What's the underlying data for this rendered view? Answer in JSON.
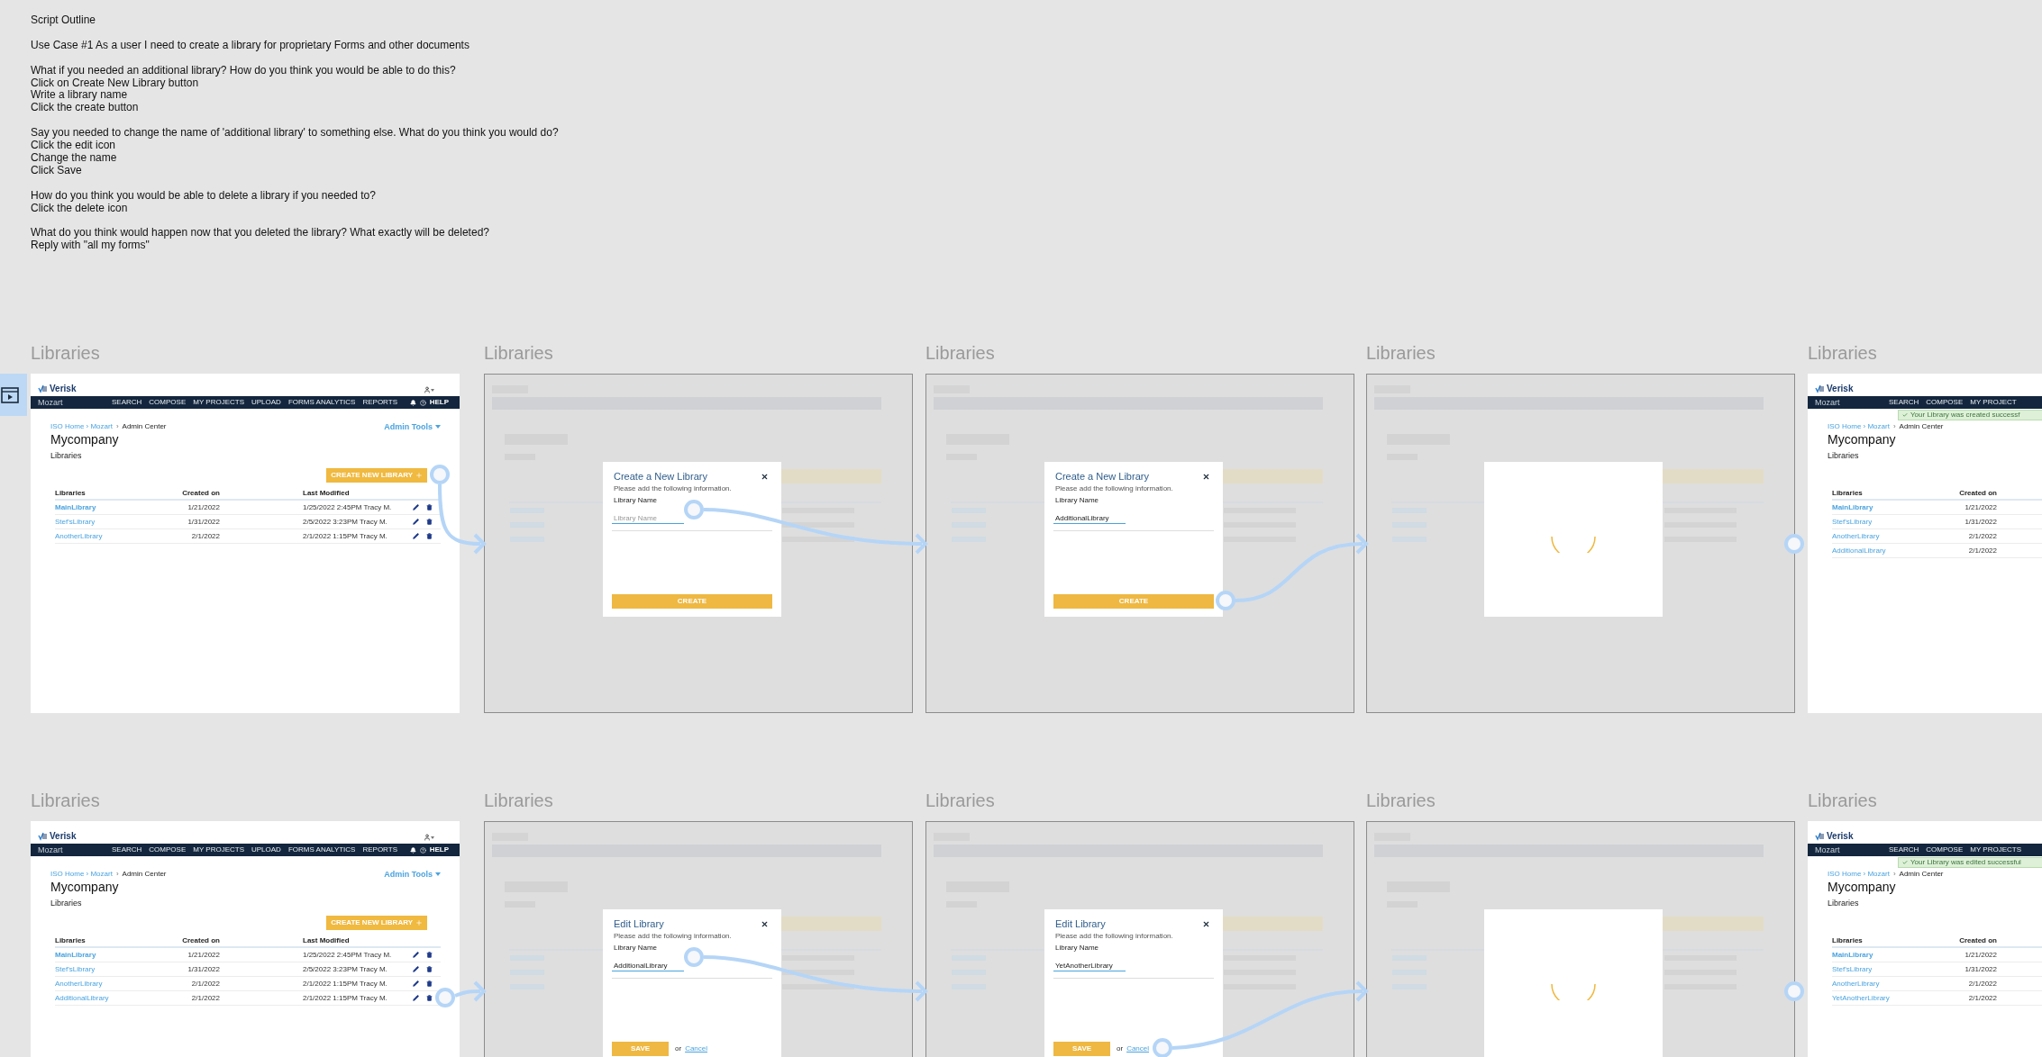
{
  "outline": {
    "title": "Script Outline",
    "paragraphs": [
      [
        "Use Case #1 As a user I need to create a library for proprietary Forms and other documents"
      ],
      [
        "What if you needed an additional library? How do you think you would be able to do this?",
        "Click on Create New Library button",
        "Write a library name",
        "Click the create button"
      ],
      [
        "Say you needed to change the name of 'additional library' to something else. What do you think you would do?",
        "Click the edit icon",
        "Change the name",
        "Click Save"
      ],
      [
        "How do you think you would be able to delete a library if you needed to?",
        "Click the delete icon"
      ],
      [
        "What do you think would happen now that you deleted the library? What exactly will be deleted?",
        "Reply with \"all my forms\""
      ]
    ]
  },
  "flows": [
    {
      "frames": [
        {
          "label": "Libraries",
          "kind": "page",
          "page": {
            "logo": "Verisk",
            "app": "Mozart",
            "nav": [
              "SEARCH",
              "COMPOSE",
              "MY PROJECTS",
              "UPLOAD",
              "FORMS ANALYTICS",
              "REPORTS"
            ],
            "help": "HELP",
            "breadcrumb": {
              "links": "ISO Home › Mozart",
              "separator": "›",
              "current": "Admin Center"
            },
            "admin_tools": "Admin Tools",
            "company": "Mycompany",
            "section": "Libraries",
            "create_button": "CREATE NEW LIBRARY",
            "columns": [
              "Libraries",
              "Created on",
              "Last Modified"
            ],
            "rows": [
              {
                "cells": [
                  "MainLibrary",
                  "1/21/2022",
                  "1/25/2022 2:45PM Tracy M."
                ],
                "bold": true
              },
              {
                "cells": [
                  "Stef'sLibrary",
                  "1/31/2022",
                  "2/5/2022 3:23PM Tracy M."
                ],
                "bold": false
              },
              {
                "cells": [
                  "AnotherLibrary",
                  "2/1/2022",
                  "2/1/2022 1:15PM Tracy M."
                ],
                "bold": false
              }
            ]
          }
        },
        {
          "label": "Libraries",
          "kind": "modal",
          "modal": {
            "title": "Create a New Library",
            "subtitle": "Please add the following information.",
            "field_label": "Library Name",
            "placeholder": "Library Name",
            "buttons": [
              {
                "label": "CREATE",
                "kind": "primary"
              }
            ]
          }
        },
        {
          "label": "Libraries",
          "kind": "modal",
          "modal": {
            "title": "Create a New Library",
            "subtitle": "Please add the following information.",
            "field_label": "Library Name",
            "value": "AdditionalLibrary",
            "buttons": [
              {
                "label": "CREATE",
                "kind": "primary"
              }
            ]
          }
        },
        {
          "label": "Libraries",
          "kind": "loading"
        },
        {
          "label": "Libraries",
          "kind": "page",
          "page": {
            "logo": "Verisk",
            "app": "Mozart",
            "nav": [
              "SEARCH",
              "COMPOSE",
              "MY PROJECT"
            ],
            "toast": "Your Library was created successf",
            "breadcrumb": {
              "links": "ISO Home › Mozart",
              "separator": "›",
              "current": "Admin Center"
            },
            "company": "Mycompany",
            "section": "Libraries",
            "columns": [
              "Libraries",
              "Created on"
            ],
            "rows": [
              {
                "cells": [
                  "MainLibrary",
                  "1/21/2022"
                ],
                "bold": true
              },
              {
                "cells": [
                  "Stef'sLibrary",
                  "1/31/2022"
                ],
                "bold": false
              },
              {
                "cells": [
                  "AnotherLibrary",
                  "2/1/2022"
                ],
                "bold": false
              },
              {
                "cells": [
                  "AdditionalLibrary",
                  "2/1/2022"
                ],
                "bold": false
              }
            ]
          }
        }
      ]
    },
    {
      "frames": [
        {
          "label": "Libraries",
          "kind": "page",
          "page": {
            "logo": "Verisk",
            "app": "Mozart",
            "nav": [
              "SEARCH",
              "COMPOSE",
              "MY PROJECTS",
              "UPLOAD",
              "FORMS ANALYTICS",
              "REPORTS"
            ],
            "help": "HELP",
            "breadcrumb": {
              "links": "ISO Home › Mozart",
              "separator": "›",
              "current": "Admin Center"
            },
            "admin_tools": "Admin Tools",
            "company": "Mycompany",
            "section": "Libraries",
            "create_button": "CREATE NEW LIBRARY",
            "columns": [
              "Libraries",
              "Created on",
              "Last Modified"
            ],
            "rows": [
              {
                "cells": [
                  "MainLibrary",
                  "1/21/2022",
                  "1/25/2022 2:45PM Tracy M."
                ],
                "bold": true
              },
              {
                "cells": [
                  "Stef'sLibrary",
                  "1/31/2022",
                  "2/5/2022 3:23PM Tracy M."
                ],
                "bold": false
              },
              {
                "cells": [
                  "AnotherLibrary",
                  "2/1/2022",
                  "2/1/2022 1:15PM Tracy M."
                ],
                "bold": false
              },
              {
                "cells": [
                  "AdditionalLibrary",
                  "2/1/2022",
                  "2/1/2022 1:15PM Tracy M."
                ],
                "bold": false
              }
            ]
          }
        },
        {
          "label": "Libraries",
          "kind": "modal",
          "modal": {
            "title": "Edit Library",
            "subtitle": "Please add the following information.",
            "field_label": "Library Name",
            "value": "AdditionalLibrary",
            "buttons": [
              {
                "label": "SAVE",
                "kind": "primary"
              },
              {
                "label": "or",
                "kind": "text"
              },
              {
                "label": "Cancel",
                "kind": "link"
              }
            ]
          }
        },
        {
          "label": "Libraries",
          "kind": "modal",
          "modal": {
            "title": "Edit Library",
            "subtitle": "Please add the following information.",
            "field_label": "Library Name",
            "value": "YetAnotherLibrary",
            "buttons": [
              {
                "label": "SAVE",
                "kind": "primary"
              },
              {
                "label": "or",
                "kind": "text"
              },
              {
                "label": "Cancel",
                "kind": "link"
              }
            ]
          }
        },
        {
          "label": "Libraries",
          "kind": "loading"
        },
        {
          "label": "Libraries",
          "kind": "page",
          "page": {
            "logo": "Verisk",
            "app": "Mozart",
            "nav": [
              "SEARCH",
              "COMPOSE",
              "MY PROJECTS"
            ],
            "toast": "Your Library was edited successful",
            "breadcrumb": {
              "links": "ISO Home › Mozart",
              "separator": "›",
              "current": "Admin Center"
            },
            "company": "Mycompany",
            "section": "Libraries",
            "columns": [
              "Libraries",
              "Created on"
            ],
            "rows": [
              {
                "cells": [
                  "MainLibrary",
                  "1/21/2022"
                ],
                "bold": true
              },
              {
                "cells": [
                  "Stef'sLibrary",
                  "1/31/2022"
                ],
                "bold": false
              },
              {
                "cells": [
                  "AnotherLibrary",
                  "2/1/2022"
                ],
                "bold": false
              },
              {
                "cells": [
                  "YetAnotherLibrary",
                  "2/1/2022"
                ],
                "bold": false
              }
            ]
          }
        }
      ]
    }
  ]
}
